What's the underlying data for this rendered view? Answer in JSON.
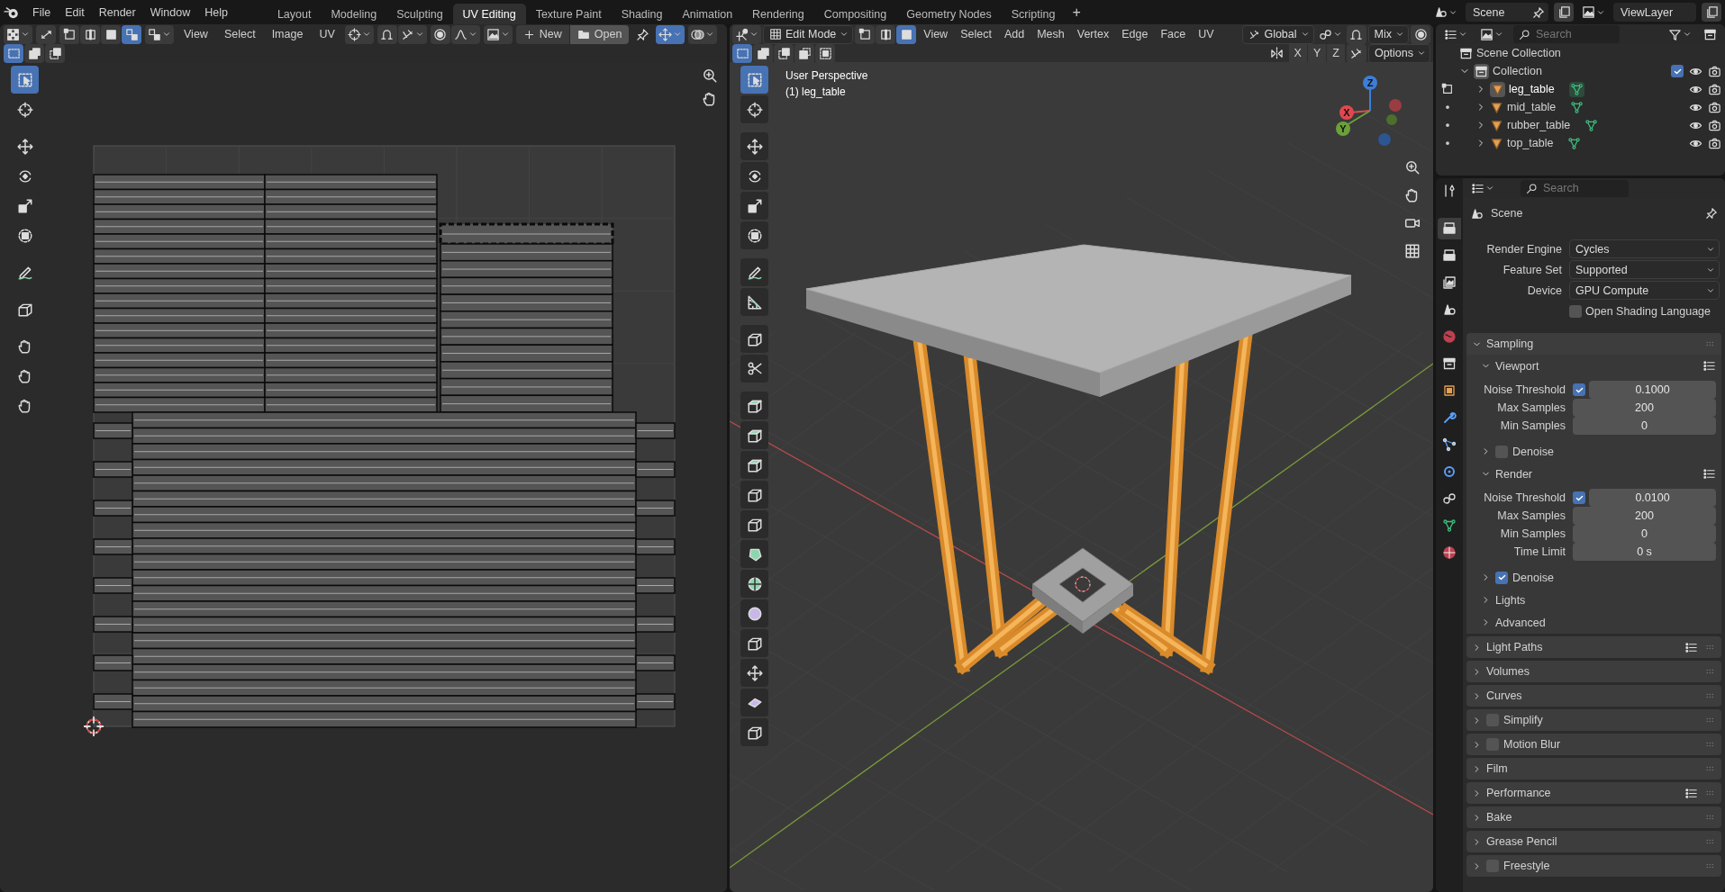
{
  "topbar": {
    "menus": [
      "File",
      "Edit",
      "Render",
      "Window",
      "Help"
    ],
    "workspaces": [
      {
        "label": "Layout",
        "selected": false
      },
      {
        "label": "Modeling",
        "selected": false
      },
      {
        "label": "Sculpting",
        "selected": false
      },
      {
        "label": "UV Editing",
        "selected": true
      },
      {
        "label": "Texture Paint",
        "selected": false
      },
      {
        "label": "Shading",
        "selected": false
      },
      {
        "label": "Animation",
        "selected": false
      },
      {
        "label": "Rendering",
        "selected": false
      },
      {
        "label": "Compositing",
        "selected": false
      },
      {
        "label": "Geometry Nodes",
        "selected": false
      },
      {
        "label": "Scripting",
        "selected": false
      }
    ],
    "add_workspace": "+",
    "scene": "Scene",
    "view_layer": "ViewLayer"
  },
  "uv_editor": {
    "select_buttons": [
      {
        "selected": false
      },
      {
        "selected": false
      },
      {
        "selected": false
      },
      {
        "selected": true
      }
    ],
    "menus": [
      "View",
      "Select",
      "Image",
      "UV"
    ],
    "new_button": "New",
    "open_button": "Open",
    "select_modes": [
      {
        "selected": true
      },
      {
        "selected": false
      },
      {
        "selected": false
      }
    ]
  },
  "viewport": {
    "mode": "Edit Mode",
    "element_modes": [
      {
        "selected": false
      },
      {
        "selected": false
      },
      {
        "selected": true
      }
    ],
    "menus": [
      "View",
      "Select",
      "Add",
      "Mesh",
      "Vertex",
      "Edge",
      "Face",
      "UV"
    ],
    "orientation": "Global",
    "falloff": "Mix",
    "select_modes": [
      {
        "selected": true
      },
      {
        "selected": false
      },
      {
        "selected": false
      },
      {
        "selected": false
      },
      {
        "selected": false
      }
    ],
    "axes": [
      "X",
      "Y",
      "Z"
    ],
    "options": "Options",
    "info": [
      "User Perspective",
      "(1) leg_table"
    ],
    "gizmo": [
      "X",
      "Y",
      "Z"
    ]
  },
  "outliner": {
    "search_placeholder": "Search",
    "scene_collection": "Scene Collection",
    "collection": {
      "label": "Collection",
      "checked": true
    },
    "objects": [
      {
        "label": "leg_table",
        "selected": true
      },
      {
        "label": "mid_table",
        "selected": false
      },
      {
        "label": "rubber_table",
        "selected": false
      },
      {
        "label": "top_table",
        "selected": false
      }
    ]
  },
  "properties": {
    "search_placeholder": "Search",
    "context": "Scene",
    "settings": [
      {
        "kind": "dropdown",
        "label": "Render Engine",
        "value": "Cycles"
      },
      {
        "kind": "dropdown",
        "label": "Feature Set",
        "value": "Supported"
      },
      {
        "kind": "dropdown",
        "label": "Device",
        "value": "GPU Compute"
      },
      {
        "kind": "check",
        "label": "Open Shading Language",
        "checked": false
      }
    ],
    "panels": [
      {
        "label": "Sampling",
        "expanded": true,
        "children": [
          {
            "label": "Viewport",
            "expanded": true,
            "presets": true,
            "rows": [
              {
                "kind": "threshold",
                "label": "Noise Threshold",
                "checked": true,
                "value": "0.1000"
              },
              {
                "kind": "number",
                "label": "Max Samples",
                "value": "200"
              },
              {
                "kind": "number",
                "label": "Min Samples",
                "value": "0"
              }
            ]
          },
          {
            "label": "Denoise",
            "expanded": false,
            "checked": false
          },
          {
            "label": "Render",
            "expanded": true,
            "presets": true,
            "rows": [
              {
                "kind": "threshold",
                "label": "Noise Threshold",
                "checked": true,
                "value": "0.0100"
              },
              {
                "kind": "number",
                "label": "Max Samples",
                "value": "200"
              },
              {
                "kind": "number",
                "label": "Min Samples",
                "value": "0"
              },
              {
                "kind": "number",
                "label": "Time Limit",
                "value": "0 s"
              }
            ]
          },
          {
            "label": "Denoise",
            "expanded": false,
            "checked": true
          },
          {
            "label": "Lights",
            "expanded": false
          },
          {
            "label": "Advanced",
            "expanded": false
          }
        ]
      },
      {
        "label": "Light Paths",
        "expanded": false,
        "presets": true
      },
      {
        "label": "Volumes",
        "expanded": false
      },
      {
        "label": "Curves",
        "expanded": false
      },
      {
        "label": "Simplify",
        "expanded": false,
        "checked": false
      },
      {
        "label": "Motion Blur",
        "expanded": false,
        "checked": false
      },
      {
        "label": "Film",
        "expanded": false
      },
      {
        "label": "Performance",
        "expanded": false,
        "presets": true
      },
      {
        "label": "Bake",
        "expanded": false
      },
      {
        "label": "Grease Pencil",
        "expanded": false
      },
      {
        "label": "Freestyle",
        "expanded": false,
        "checked": false
      }
    ]
  }
}
